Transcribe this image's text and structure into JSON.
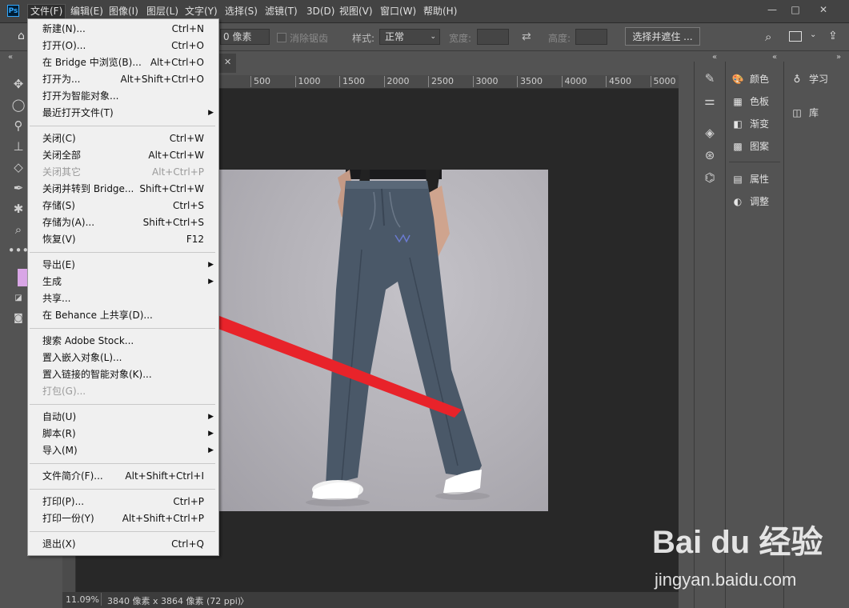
{
  "app": {
    "logo_text": "Ps"
  },
  "menubar": {
    "items": [
      "文件(F)",
      "编辑(E)",
      "图像(I)",
      "图层(L)",
      "文字(Y)",
      "选择(S)",
      "滤镜(T)",
      "3D(D)",
      "视图(V)",
      "窗口(W)",
      "帮助(H)"
    ],
    "active_index": 0
  },
  "window_controls": {
    "minimize": "—",
    "maximize": "□",
    "close": "✕"
  },
  "options_bar": {
    "feather_value": "0 像素",
    "antialias_label": "消除锯齿",
    "style_label": "样式:",
    "style_value": "正常",
    "width_label": "宽度:",
    "height_label": "高度:",
    "select_mask_button": "选择并遮住 ..."
  },
  "ruler": {
    "ticks": [
      "500",
      "1000",
      "1500",
      "2000",
      "2500",
      "3000",
      "3500",
      "4000",
      "4500",
      "5000"
    ]
  },
  "status": {
    "zoom": "11.09%",
    "doc_info": "3840 像素 x 3864 像素 (72 ppi)",
    "arrow": "〉"
  },
  "panels": {
    "col2": [
      {
        "label": "颜色",
        "icon": "palette-icon",
        "glyph": "🎨"
      },
      {
        "label": "色板",
        "icon": "swatches-icon",
        "glyph": "▦"
      },
      {
        "label": "渐变",
        "icon": "gradient-icon",
        "glyph": "◧"
      },
      {
        "label": "图案",
        "icon": "pattern-icon",
        "glyph": "▩"
      },
      {
        "label": "属性",
        "icon": "properties-icon",
        "glyph": "▤"
      },
      {
        "label": "调整",
        "icon": "adjustments-icon",
        "glyph": "◐"
      }
    ],
    "col3": [
      {
        "label": "学习",
        "icon": "lightbulb-icon",
        "glyph": "♁"
      },
      {
        "label": "库",
        "icon": "library-icon",
        "glyph": "◫"
      }
    ]
  },
  "file_menu": [
    {
      "label": "新建(N)...",
      "shortcut": "Ctrl+N"
    },
    {
      "label": "打开(O)...",
      "shortcut": "Ctrl+O"
    },
    {
      "label": "在 Bridge 中浏览(B)...",
      "shortcut": "Alt+Ctrl+O"
    },
    {
      "label": "打开为...",
      "shortcut": "Alt+Shift+Ctrl+O"
    },
    {
      "label": "打开为智能对象...",
      "shortcut": ""
    },
    {
      "label": "最近打开文件(T)",
      "shortcut": "",
      "submenu": true
    },
    {
      "label": "关闭(C)",
      "shortcut": "Ctrl+W",
      "sep_before": true
    },
    {
      "label": "关闭全部",
      "shortcut": "Alt+Ctrl+W"
    },
    {
      "label": "关闭其它",
      "shortcut": "Alt+Ctrl+P",
      "disabled": true
    },
    {
      "label": "关闭并转到 Bridge...",
      "shortcut": "Shift+Ctrl+W"
    },
    {
      "label": "存储(S)",
      "shortcut": "Ctrl+S"
    },
    {
      "label": "存储为(A)...",
      "shortcut": "Shift+Ctrl+S"
    },
    {
      "label": "恢复(V)",
      "shortcut": "F12"
    },
    {
      "label": "导出(E)",
      "shortcut": "",
      "submenu": true,
      "sep_before": true
    },
    {
      "label": "生成",
      "shortcut": "",
      "submenu": true
    },
    {
      "label": "共享...",
      "shortcut": ""
    },
    {
      "label": "在 Behance 上共享(D)...",
      "shortcut": ""
    },
    {
      "label": "搜索 Adobe Stock...",
      "shortcut": "",
      "sep_before": true
    },
    {
      "label": "置入嵌入对象(L)...",
      "shortcut": ""
    },
    {
      "label": "置入链接的智能对象(K)...",
      "shortcut": ""
    },
    {
      "label": "打包(G)...",
      "shortcut": "",
      "disabled": true
    },
    {
      "label": "自动(U)",
      "shortcut": "",
      "submenu": true,
      "sep_before": true
    },
    {
      "label": "脚本(R)",
      "shortcut": "",
      "submenu": true
    },
    {
      "label": "导入(M)",
      "shortcut": "",
      "submenu": true
    },
    {
      "label": "文件简介(F)...",
      "shortcut": "Alt+Shift+Ctrl+I",
      "sep_before": true
    },
    {
      "label": "打印(P)...",
      "shortcut": "Ctrl+P",
      "sep_before": true
    },
    {
      "label": "打印一份(Y)",
      "shortcut": "Alt+Shift+Ctrl+P"
    },
    {
      "label": "退出(X)",
      "shortcut": "Ctrl+Q",
      "sep_before": true
    }
  ],
  "watermark": {
    "logo": "Bai du 经验",
    "url": "jingyan.baidu.com"
  },
  "colors": {
    "foreground_swatch": "#d9a6e6",
    "annotation_arrow": "#e8232a"
  }
}
